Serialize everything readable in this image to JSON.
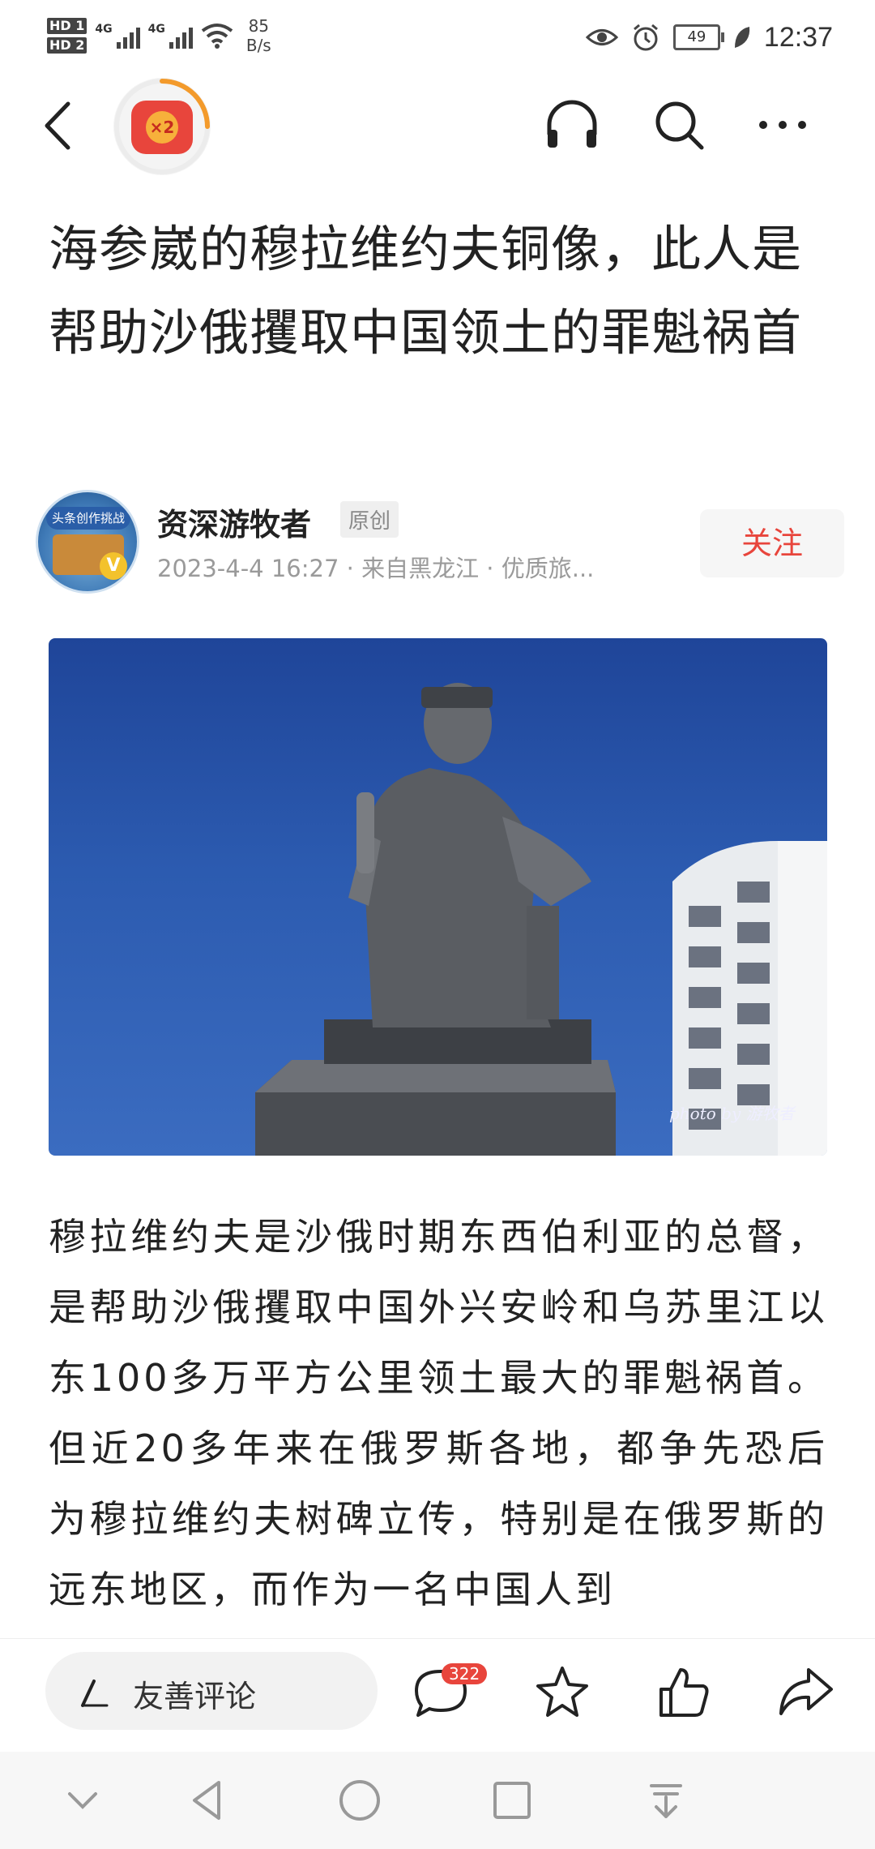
{
  "status_bar": {
    "hd1": "HD 1",
    "hd2": "HD 2",
    "net1": "4G",
    "net2": "4G",
    "speed_value": "85",
    "speed_unit": "B/s",
    "battery": "49",
    "time": "12:37"
  },
  "top_nav": {
    "coin_badge": "×2",
    "icons": [
      "back-icon",
      "headphones-icon",
      "search-icon",
      "more-icon"
    ]
  },
  "article": {
    "title": "海参崴的穆拉维约夫铜像，此人是帮助沙俄攫取中国领土的罪魁祸首",
    "author": {
      "name": "资深游牧者",
      "tag": "原创",
      "avatar_ribbon": "头条创作挑战赛",
      "avatar_v": "V",
      "meta": "2023-4-4 16:27 · 来自黑龙江 · 优质旅..."
    },
    "follow_label": "关注",
    "photo_watermark": "photo by 游牧者",
    "body": "穆拉维约夫是沙俄时期东西伯利亚的总督，是帮助沙俄攫取中国外兴安岭和乌苏里江以东100多万平方公里领土最大的罪魁祸首。但近20多年来在俄罗斯各地，都争先恐后为穆拉维约夫树碑立传，特别是在俄罗斯的远东地区，而作为一名中国人到"
  },
  "action_bar": {
    "comment_placeholder": "友善评论",
    "comment_count": "322",
    "icons": [
      "comment-icon",
      "star-icon",
      "thumbs-up-icon",
      "share-icon"
    ]
  },
  "system_nav": {
    "icons": [
      "chevron-down-icon",
      "back-triangle-icon",
      "home-circle-icon",
      "recents-square-icon",
      "download-icon"
    ]
  },
  "colors": {
    "accent_red": "#e8453c",
    "sky_blue": "#2c5bb0"
  }
}
